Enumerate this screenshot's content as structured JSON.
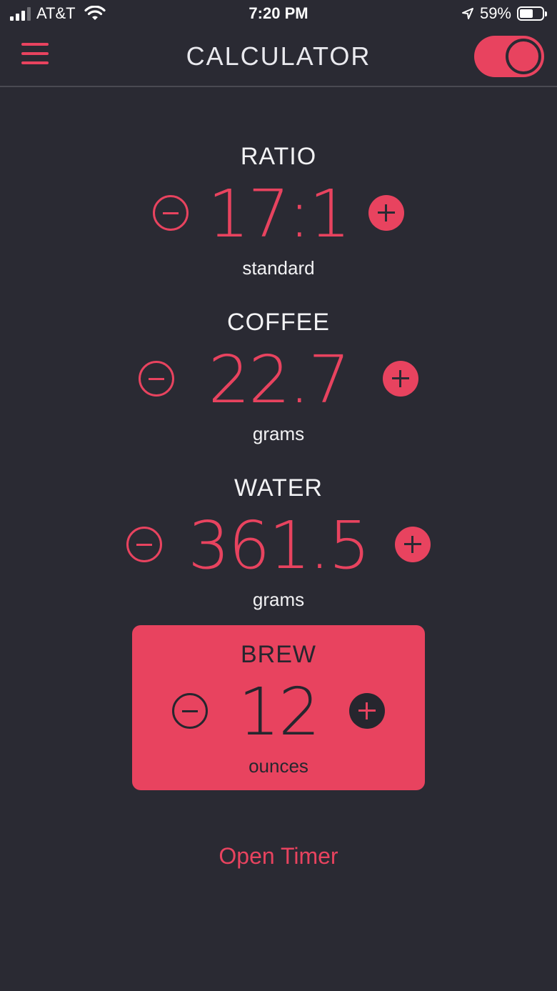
{
  "status_bar": {
    "carrier": "AT&T",
    "time": "7:20 PM",
    "battery_percent": "59%",
    "battery_level": 0.59,
    "signal_bars": 3
  },
  "header": {
    "title": "CALCULATOR",
    "menu_icon": "hamburger-menu-icon",
    "toggle_on": true
  },
  "ratio": {
    "label": "RATIO",
    "value": "17:1",
    "unit": "standard"
  },
  "coffee": {
    "label": "COFFEE",
    "value": "22.7",
    "unit": "grams"
  },
  "water": {
    "label": "WATER",
    "value": "361.5",
    "unit": "grams"
  },
  "brew": {
    "label": "BREW",
    "value": "12",
    "unit": "ounces"
  },
  "open_timer_label": "Open Timer",
  "colors": {
    "accent": "#e8435f",
    "background": "#2a2a33",
    "text": "#f2f2f4",
    "dark": "#26262e"
  }
}
